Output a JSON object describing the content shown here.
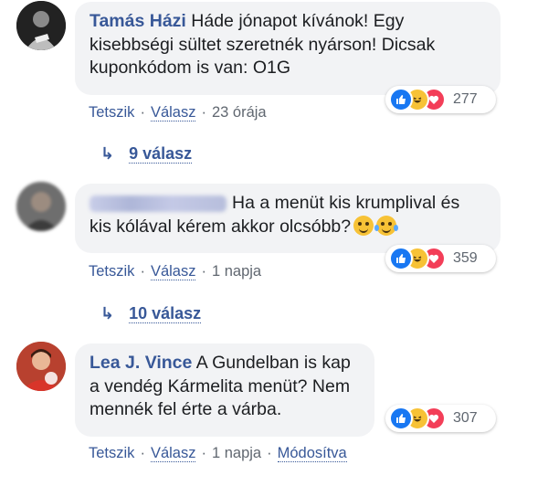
{
  "comments": [
    {
      "author": "Tamás Házi",
      "text": "Háde jónapot kívánok! Egy kisebbségi sültet szeretnék nyárson! Dicsak kuponkódom is van: O1G",
      "reactions_count": "277",
      "like_label": "Tetszik",
      "reply_label": "Válasz",
      "time": "23 órája",
      "replies_label": "9 válasz"
    },
    {
      "author": "",
      "text": "Ha a menüt kis krumplival és kis kólával kérem akkor olcsóbb?",
      "reactions_count": "359",
      "like_label": "Tetszik",
      "reply_label": "Válasz",
      "time": "1 napja",
      "replies_label": "10 válasz"
    },
    {
      "author": "Lea J. Vince",
      "text": "A Gundelban is kap a vendég Kármelita menüt? Nem mennék fel érte a várba.",
      "reactions_count": "307",
      "like_label": "Tetszik",
      "reply_label": "Válasz",
      "time": "1 napja",
      "edited_label": "Módosítva"
    }
  ],
  "colors": {
    "link": "#385898",
    "bubble": "#f2f3f5",
    "meta": "#606770",
    "like": "#1877f2",
    "love": "#f33e58",
    "haha": "#f7c236"
  },
  "icons": {
    "reaction_like": "thumbs-up-icon",
    "reaction_haha": "laughing-face-icon",
    "reaction_love": "heart-icon",
    "reply_arrow": "reply-arrow-icon"
  }
}
